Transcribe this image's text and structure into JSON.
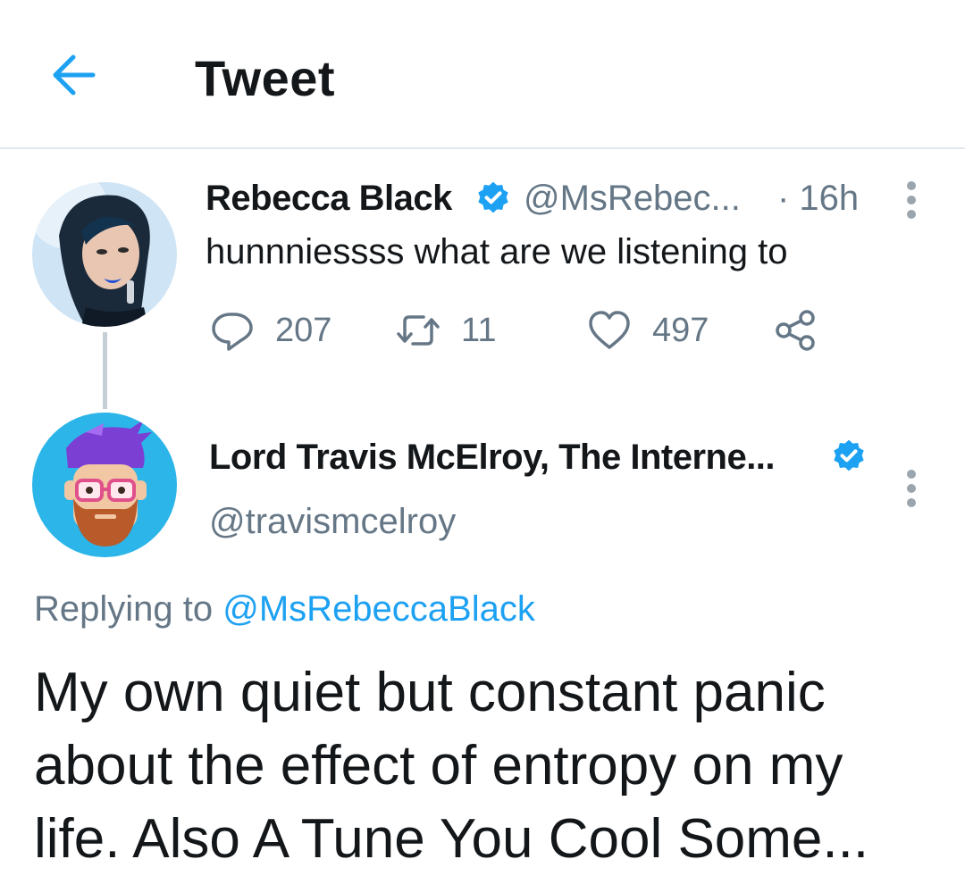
{
  "header": {
    "title": "Tweet",
    "back_icon": "arrow-left-icon",
    "accent": "#1da1f2"
  },
  "parent_tweet": {
    "author_name": "Rebecca Black",
    "verified": true,
    "handle": "@MsRebec...",
    "time": "· 16h",
    "text": "hunnniessss what are we listening to",
    "actions": {
      "reply_count": "207",
      "retweet_count": "11",
      "like_count": "497"
    }
  },
  "reply_tweet": {
    "author_name": "Lord Travis McElroy, The Interne...",
    "verified": true,
    "handle": "@travismcelroy",
    "replying_prefix": "Replying to",
    "replying_to": "@MsRebeccaBlack",
    "text": "My own quiet but constant panic about the effect of entropy on my life. Also A Tune You Cool Some..."
  }
}
